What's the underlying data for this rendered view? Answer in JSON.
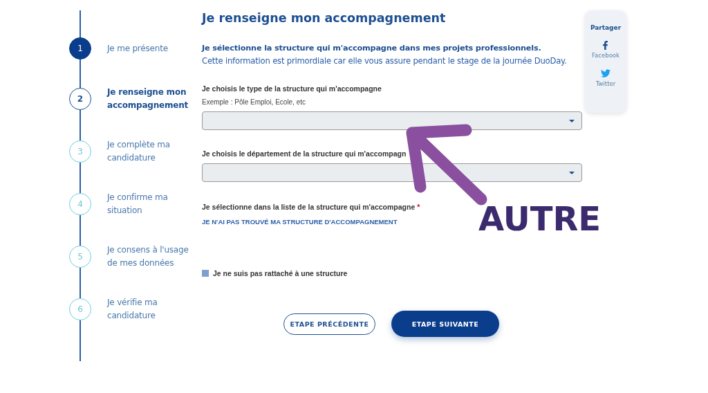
{
  "steps": [
    {
      "number": "1",
      "label": "Je me présente",
      "completed": true,
      "selected": false
    },
    {
      "number": "2",
      "label": "Je renseigne mon accompagnement",
      "completed": false,
      "selected": true
    },
    {
      "number": "3",
      "label": "Je complète ma candidature",
      "completed": false,
      "selected": false
    },
    {
      "number": "4",
      "label": "Je confirme ma situation",
      "completed": false,
      "selected": false
    },
    {
      "number": "5",
      "label": "Je consens à l'usage de mes données",
      "completed": false,
      "selected": false
    },
    {
      "number": "6",
      "label": "Je vérifie ma candidature",
      "completed": false,
      "selected": false
    }
  ],
  "title": "Je renseigne mon accompagnement",
  "intro": {
    "lead": "Je sélectionne la structure qui m'accompagne dans mes projets professionnels.",
    "text": "Cette information est primordiale car elle vous assure pendant le stage de la journée DuoDay."
  },
  "fields": [
    {
      "label": "Je choisis le type de la structure qui m'accompagne",
      "hint": "Exemple : Pôle Emploi, Ecole, etc"
    },
    {
      "label": "Je choisis le département de la structure qui m'accompagn"
    }
  ],
  "structure_list": {
    "label": "Je sélectionne dans la liste de la structure qui m'accompagne",
    "required_mark": "*",
    "link": "JE N'AI PAS TROUVÉ MA STRUCTURE D'ACCOMPAGNEMENT"
  },
  "no_structure": {
    "label": "Je ne suis pas rattaché à une structure",
    "checked": false
  },
  "buttons": [
    {
      "label": "ETAPE PRÉCÉDENTE",
      "kind": "secondary"
    },
    {
      "label": "ETAPE SUIVANTE",
      "kind": "primary"
    }
  ],
  "share": {
    "title": "Partager",
    "items": [
      {
        "label": "Facebook",
        "kind": "facebook"
      },
      {
        "label": "Twitter",
        "kind": "twitter"
      }
    ]
  },
  "annotation": {
    "label": "AUTRE"
  }
}
